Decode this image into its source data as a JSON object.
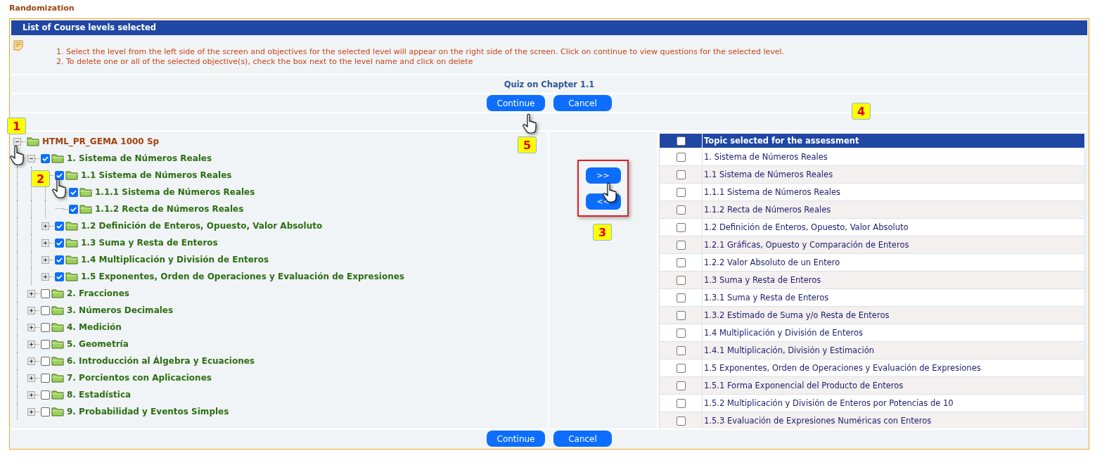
{
  "page_title": "Randomization",
  "panel": {
    "header": "List of Course levels selected",
    "instructions": [
      "1. Select the level from the left side of the screen and objectives for the selected level will appear on the right side of the screen. Click on continue to view questions for the selected level.",
      "2. To delete one or all of the selected objective(s), check the box next to the level name and click on delete"
    ]
  },
  "quiz_title": "Quiz on Chapter 1.1",
  "top_buttons": [
    "Continue",
    "Cancel"
  ],
  "tree": {
    "label": "HTML_PR_GEMA 1000 Sp",
    "expanded": true,
    "children": [
      {
        "label": "1. Sistema de Números Reales",
        "checked": true,
        "expanded": true,
        "children": [
          {
            "label": "1.1 Sistema de Números Reales",
            "checked": true,
            "children": [
              {
                "label": "1.1.1 Sistema de Números Reales",
                "checked": true
              },
              {
                "label": "1.1.2 Recta de Números Reales",
                "checked": true
              }
            ]
          },
          {
            "label": "1.2 Definición de Enteros, Opuesto, Valor Absoluto",
            "checked": true,
            "expanded": false
          },
          {
            "label": "1.3 Suma y Resta de Enteros",
            "checked": true,
            "expanded": false
          },
          {
            "label": "1.4 Multiplicación y División de Enteros",
            "checked": true,
            "expanded": false
          },
          {
            "label": "1.5 Exponentes, Orden de Operaciones y Evaluación de Expresiones",
            "checked": true,
            "expanded": false
          }
        ]
      },
      {
        "label": "2. Fracciones",
        "checked": false,
        "expanded": false
      },
      {
        "label": "3. Números Decimales",
        "checked": false,
        "expanded": false
      },
      {
        "label": "4. Medición",
        "checked": false,
        "expanded": false
      },
      {
        "label": "5. Geometría",
        "checked": false,
        "expanded": false
      },
      {
        "label": "6. Introducción al Álgebra y Ecuaciones",
        "checked": false,
        "expanded": false
      },
      {
        "label": "7. Porcientos con Aplicaciones",
        "checked": false,
        "expanded": false
      },
      {
        "label": "8. Estadística",
        "checked": false,
        "expanded": false
      },
      {
        "label": "9. Probabilidad y Eventos Simples",
        "checked": false,
        "expanded": false
      }
    ]
  },
  "move_buttons": [
    ">>",
    "<<"
  ],
  "table": {
    "header_checked": false,
    "column_header": "Topic selected for the assessment",
    "rows": [
      {
        "label": "1. Sistema de Números Reales",
        "checked": false
      },
      {
        "label": "1.1 Sistema de Números Reales",
        "checked": false
      },
      {
        "label": "1.1.1 Sistema de Números Reales",
        "checked": false
      },
      {
        "label": "1.1.2 Recta de Números Reales",
        "checked": false
      },
      {
        "label": "1.2 Definición de Enteros, Opuesto, Valor Absoluto",
        "checked": false
      },
      {
        "label": "1.2.1 Gráficas, Opuesto y Comparación de Enteros",
        "checked": false
      },
      {
        "label": "1.2.2 Valor Absoluto de un Entero",
        "checked": false
      },
      {
        "label": "1.3 Suma y Resta de Enteros",
        "checked": false
      },
      {
        "label": "1.3.1 Suma y Resta de Enteros",
        "checked": false
      },
      {
        "label": "1.3.2 Estimado de Suma y/o Resta de Enteros",
        "checked": false
      },
      {
        "label": "1.4 Multiplicación y División de Enteros",
        "checked": false
      },
      {
        "label": "1.4.1 Multiplicación, División y Estimación",
        "checked": false
      },
      {
        "label": "1.5 Exponentes, Orden de Operaciones y Evaluación de Expresiones",
        "checked": false
      },
      {
        "label": "1.5.1 Forma Exponencial del Producto de Enteros",
        "checked": false
      },
      {
        "label": "1.5.2 Multiplicación y División de Enteros por Potencias de 10",
        "checked": false
      },
      {
        "label": "1.5.3 Evaluación de Expresiones Numéricas con Enteros",
        "checked": false
      }
    ]
  },
  "bottom_buttons": [
    "Continue",
    "Cancel"
  ],
  "callouts": [
    "1",
    "2",
    "3",
    "4",
    "5"
  ]
}
